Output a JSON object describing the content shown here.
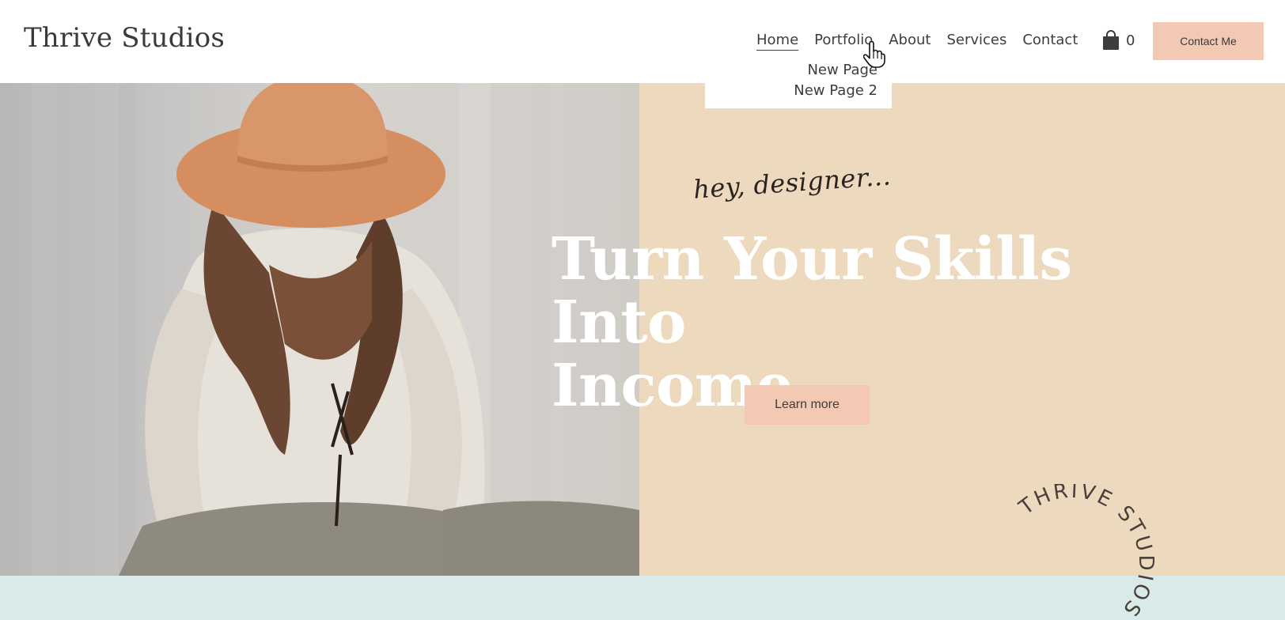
{
  "header": {
    "site_title": "Thrive Studios",
    "nav": [
      {
        "label": "Home",
        "active": true
      },
      {
        "label": "Portfolio",
        "active": false
      },
      {
        "label": "About",
        "active": false
      },
      {
        "label": "Services",
        "active": false
      },
      {
        "label": "Contact",
        "active": false
      }
    ],
    "cart_icon": "shopping-bag-icon",
    "cart_count": "0",
    "contact_button": "Contact Me"
  },
  "dropdown": {
    "items": [
      "New Page",
      "New Page 2"
    ]
  },
  "hero": {
    "script_text": "hey, designer...",
    "headline_line1": "Turn Your Skills Into",
    "headline_line2": "Income.",
    "button_label": "Learn more"
  },
  "badge": {
    "circular_text": "THRIVE STUDIOS THRIVE STUDIOS "
  },
  "colors": {
    "accent_button": "#f4c9b4",
    "hero_panel": "#eddabe",
    "bottom_band": "#d8ebe8",
    "hat": "#d48e5f"
  }
}
